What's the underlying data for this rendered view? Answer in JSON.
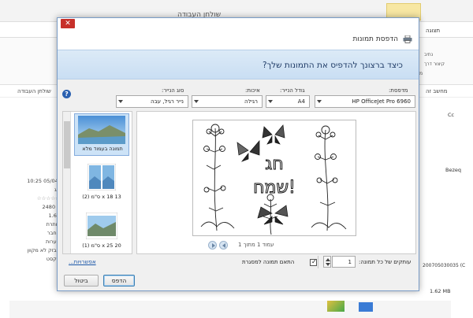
{
  "background": {
    "window_title": "שולחן העבודה",
    "tabs": [
      "תצוגה",
      "נתיב"
    ],
    "ribbon_texts": [
      "קיצור דרך",
      "מ"
    ],
    "address_left": "שולחן העבודה",
    "address_right": "מחשב זה",
    "left_meta": [
      "10:25 05/04/",
      "תג",
      "☆☆☆☆☆",
      "2480 x",
      "1.62",
      "כותרת",
      "מחבר",
      "הערות",
      "מבזק לא מקוון",
      "טקסט"
    ],
    "right_items": {
      "c1": "Cc",
      "c2": "Bezeq",
      "c3": "200705030035 (C",
      "c4": "1.62 MB"
    }
  },
  "dialog": {
    "title": "הדפסת תמונות",
    "question": "כיצד ברצונך להדפיס את התמונות שלך?",
    "printer_label": "מדפסת:",
    "printer_value": "HP OfficeJet Pro 6960",
    "paper_size_label": "גודל הנייר:",
    "paper_size_value": "A4",
    "quality_label": "איכות:",
    "quality_value": "רגילה",
    "paper_type_label": "סוג הנייר:",
    "paper_type_value": "נייר רגיל, עבה",
    "page_counter": "עמוד 1 מתוך 1",
    "preview": {
      "text_line1": "חג",
      "text_line2": "שמח!"
    },
    "layouts": [
      {
        "caption": "תמונה בעמוד מלא",
        "selected": true
      },
      {
        "caption": "13 x 18 ס\"מ (2)",
        "selected": false
      },
      {
        "caption": "20 x 25 ס\"מ (1)",
        "selected": false
      }
    ],
    "options_link": "אפשרויות...",
    "copies_label": "עותקים של כל תמונה:",
    "copies_value": "1",
    "fit_label": "התאם תמונה למסגרת",
    "fit_checked": true,
    "print_button": "הדפס",
    "cancel_button": "ביטול",
    "colors": {
      "accent": "#1f3b66",
      "band": "#c9def3",
      "close": "#c7302a"
    }
  }
}
